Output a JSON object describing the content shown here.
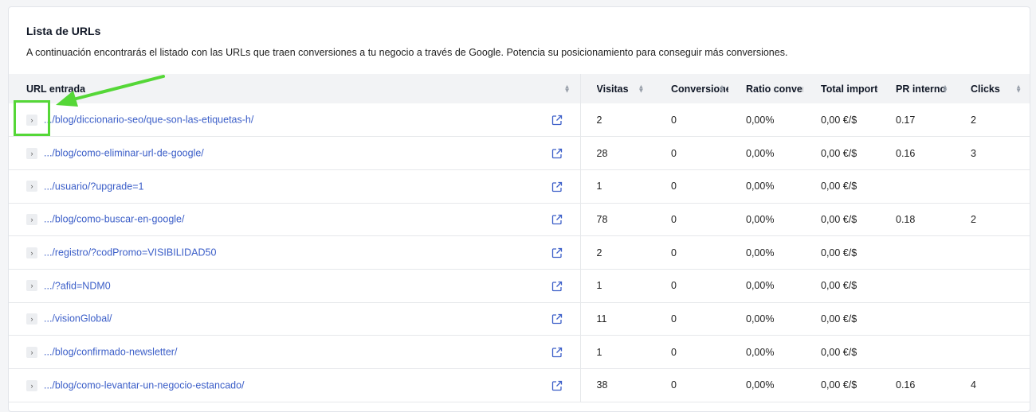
{
  "card": {
    "title": "Lista de URLs",
    "description": "A continuación encontrarás el listado con las URLs que traen conversiones a tu negocio a través de Google. Potencia su posicionamiento para conseguir más conversiones."
  },
  "columns": {
    "url": "URL entrada",
    "visitas": "Visitas",
    "conversiones": "Conversiones",
    "ratio": "Ratio conversión",
    "total": "Total importe",
    "pr": "PR interno",
    "clicks": "Clicks"
  },
  "rows": [
    {
      "url": ".../blog/diccionario-seo/que-son-las-etiquetas-h/",
      "visitas": "2",
      "conversiones": "0",
      "ratio": "0,00%",
      "total": "0,00 €/$",
      "pr": "0.17",
      "clicks": "2"
    },
    {
      "url": ".../blog/como-eliminar-url-de-google/",
      "visitas": "28",
      "conversiones": "0",
      "ratio": "0,00%",
      "total": "0,00 €/$",
      "pr": "0.16",
      "clicks": "3"
    },
    {
      "url": ".../usuario/?upgrade=1",
      "visitas": "1",
      "conversiones": "0",
      "ratio": "0,00%",
      "total": "0,00 €/$",
      "pr": "",
      "clicks": ""
    },
    {
      "url": ".../blog/como-buscar-en-google/",
      "visitas": "78",
      "conversiones": "0",
      "ratio": "0,00%",
      "total": "0,00 €/$",
      "pr": "0.18",
      "clicks": "2"
    },
    {
      "url": ".../registro/?codPromo=VISIBILIDAD50",
      "visitas": "2",
      "conversiones": "0",
      "ratio": "0,00%",
      "total": "0,00 €/$",
      "pr": "",
      "clicks": ""
    },
    {
      "url": ".../?afid=NDM0",
      "visitas": "1",
      "conversiones": "0",
      "ratio": "0,00%",
      "total": "0,00 €/$",
      "pr": "",
      "clicks": ""
    },
    {
      "url": ".../visionGlobal/",
      "visitas": "11",
      "conversiones": "0",
      "ratio": "0,00%",
      "total": "0,00 €/$",
      "pr": "",
      "clicks": ""
    },
    {
      "url": ".../blog/confirmado-newsletter/",
      "visitas": "1",
      "conversiones": "0",
      "ratio": "0,00%",
      "total": "0,00 €/$",
      "pr": "",
      "clicks": ""
    },
    {
      "url": ".../blog/como-levantar-un-negocio-estancado/",
      "visitas": "38",
      "conversiones": "0",
      "ratio": "0,00%",
      "total": "0,00 €/$",
      "pr": "0.16",
      "clicks": "4"
    }
  ],
  "icons": {
    "expand": "chevron-right-icon",
    "external": "external-link-icon",
    "sort": "sort-icon"
  },
  "colors": {
    "link": "#3b5ec8",
    "highlight": "#55d737",
    "header_bg": "#f2f3f5"
  }
}
